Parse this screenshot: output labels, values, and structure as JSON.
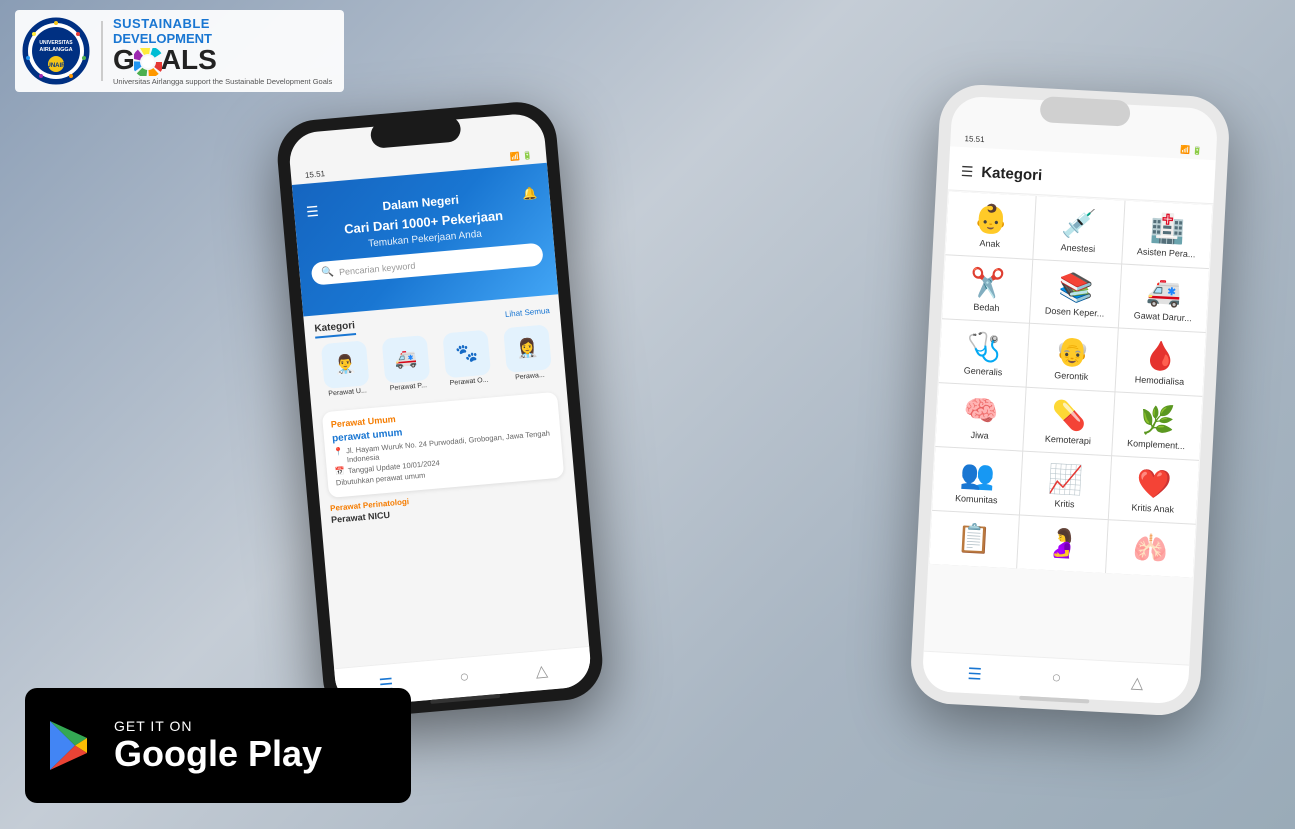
{
  "header": {
    "university": "Universitas Airlangga",
    "sdg_line1": "SUSTAINABLE",
    "sdg_line2": "DEVELOPMENT",
    "sdg_goals": "GOALS",
    "subtitle": "Universitas Airlangga support the Sustainable Development Goals"
  },
  "phone_left": {
    "status_time": "15.51",
    "app_title": "Dalam Negeri",
    "hero_line1": "Cari Dari 1000+ Pekerjaan",
    "hero_line2": "Temukan Pekerjaan Anda",
    "search_placeholder": "Pencarian keyword",
    "lihat_semua": "Lihat Semua",
    "section_label": "Kategori",
    "categories": [
      {
        "icon": "👨‍⚕️",
        "label": "Perawat U..."
      },
      {
        "icon": "🚑",
        "label": "Perawat P..."
      },
      {
        "icon": "🐕",
        "label": "Perawat O..."
      },
      {
        "icon": "👩‍⚕️",
        "label": "Perawa..."
      }
    ],
    "job_card_title": "Perawat Umum",
    "job_name": "perawat umum",
    "job_address": "Jl. Hayam Wuruk No. 24 Purwodadi, Grobogan, Jawa Tengah Indonesia",
    "job_date": "Tanggal Update 10/01/2024",
    "job_desc": "Dibutuhkan perawat umum",
    "perawat_perinatologi": "Perawat Perinatologi",
    "perawat_nicu": "Perawat NICU"
  },
  "phone_right": {
    "status_time": "15.51",
    "app_title": "Kategori",
    "categories": [
      {
        "icon": "👶",
        "label": "Anak",
        "color": "#e3f2fd"
      },
      {
        "icon": "💉",
        "label": "Anestesi",
        "color": "#e1f5fe"
      },
      {
        "icon": "🏥",
        "label": "Asisten Pera...",
        "color": "#f3e5f5"
      },
      {
        "icon": "✂️",
        "label": "Bedah",
        "color": "#fce4ec"
      },
      {
        "icon": "📚",
        "label": "Dosen Keper...",
        "color": "#e8f5e9"
      },
      {
        "icon": "🚑",
        "label": "Gawat Darur...",
        "color": "#fff8e1"
      },
      {
        "icon": "🩺",
        "label": "Generalis",
        "color": "#f1f8e9"
      },
      {
        "icon": "👴",
        "label": "Gerontik",
        "color": "#fbe9e7"
      },
      {
        "icon": "🩸",
        "label": "Hemodialisa",
        "color": "#ffebee"
      },
      {
        "icon": "🧠",
        "label": "Jiwa",
        "color": "#e0f7fa"
      },
      {
        "icon": "💊",
        "label": "Kemoterapi",
        "color": "#e8eaf6"
      },
      {
        "icon": "🌿",
        "label": "Komplement...",
        "color": "#f9fbe7"
      },
      {
        "icon": "👥",
        "label": "Komunitas",
        "color": "#e8f5e9"
      },
      {
        "icon": "📈",
        "label": "Kritis",
        "color": "#fce4ec"
      },
      {
        "icon": "❤️",
        "label": "Kritis Anak",
        "color": "#ffebee"
      },
      {
        "icon": "📋",
        "label": "",
        "color": "#f5f5f5"
      },
      {
        "icon": "🤰",
        "label": "",
        "color": "#fce4ec"
      },
      {
        "icon": "🫁",
        "label": "",
        "color": "#e3f2fd"
      }
    ]
  },
  "google_play": {
    "get_it_on": "GET IT ON",
    "store_name": "Google Play"
  }
}
